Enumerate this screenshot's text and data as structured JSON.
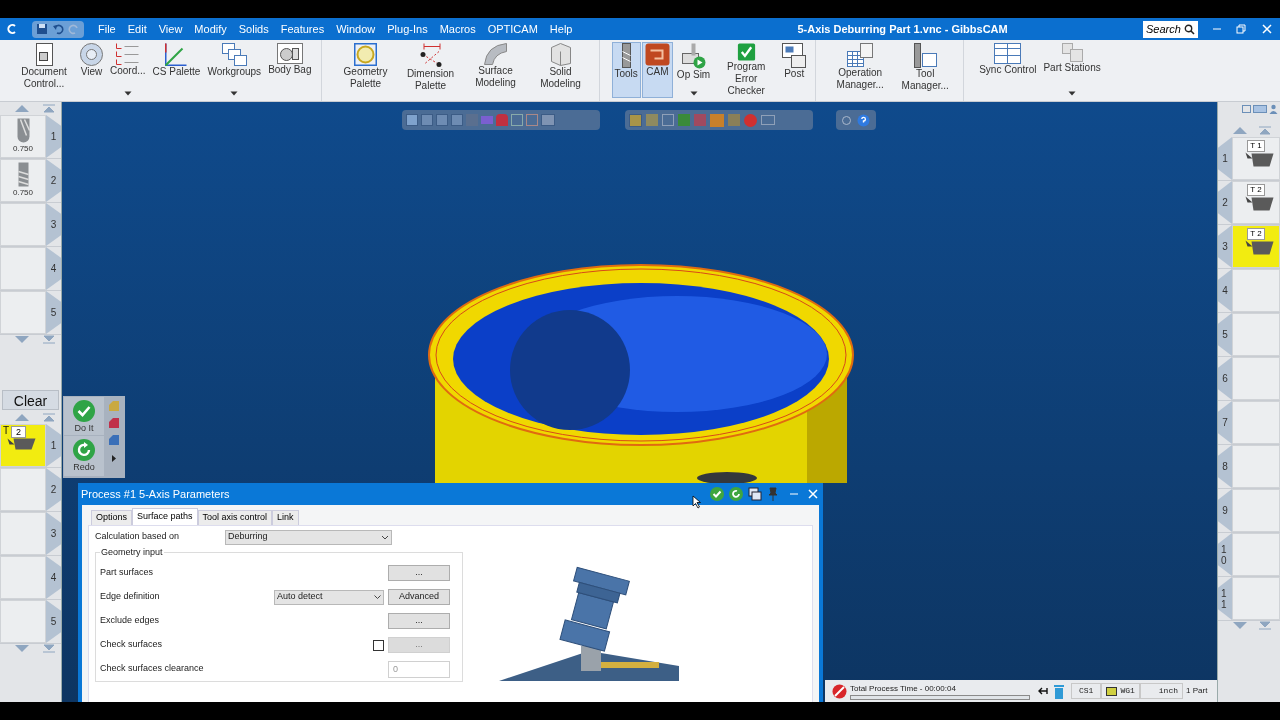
{
  "window": {
    "title": "5-Axis Deburring Part 1.vnc - GibbsCAM",
    "search_placeholder": "Search"
  },
  "menu": [
    "File",
    "Edit",
    "View",
    "Modify",
    "Solids",
    "Features",
    "Window",
    "Plug-Ins",
    "Macros",
    "OPTICAM",
    "Help"
  ],
  "ribbon_groups": [
    [
      {
        "label": "Document Control...",
        "selected": false,
        "dropdown": false
      },
      {
        "label": "View",
        "selected": false,
        "dropdown": false
      },
      {
        "label": "Coord...",
        "selected": false,
        "dropdown": true
      },
      {
        "label": "CS Palette",
        "selected": false,
        "dropdown": false
      },
      {
        "label": "Workgroups",
        "selected": false,
        "dropdown": true
      },
      {
        "label": "Body Bag",
        "selected": false,
        "dropdown": false
      }
    ],
    [
      {
        "label": "Geometry Palette",
        "selected": false,
        "dropdown": false
      },
      {
        "label": "Dimension Palette",
        "selected": false,
        "dropdown": false
      },
      {
        "label": "Surface Modeling",
        "selected": false,
        "dropdown": false
      },
      {
        "label": "Solid Modeling",
        "selected": false,
        "dropdown": false
      }
    ],
    [
      {
        "label": "Tools",
        "selected": true,
        "dropdown": false
      },
      {
        "label": "CAM",
        "selected": true,
        "dropdown": false
      },
      {
        "label": "Op Sim",
        "selected": false,
        "dropdown": true
      },
      {
        "label": "Program Error Checker",
        "selected": false,
        "dropdown": false
      },
      {
        "label": "Post",
        "selected": false,
        "dropdown": false
      }
    ],
    [
      {
        "label": "Operation Manager...",
        "selected": false,
        "dropdown": false
      },
      {
        "label": "Tool Manager...",
        "selected": false,
        "dropdown": false
      }
    ],
    [
      {
        "label": "Sync Control",
        "selected": false,
        "dropdown": false
      },
      {
        "label": "Part Stations",
        "selected": false,
        "dropdown": true
      }
    ]
  ],
  "tool_list": [
    {
      "number": "1",
      "kind": "ball",
      "size": "0.750"
    },
    {
      "number": "2",
      "kind": "flat",
      "size": "0.750"
    },
    {
      "number": "3",
      "kind": "empty"
    },
    {
      "number": "4",
      "kind": "empty"
    },
    {
      "number": "5",
      "kind": "empty"
    }
  ],
  "process_list": {
    "clear": "Clear",
    "do_it": "Do It",
    "redo": "Redo",
    "items": [
      {
        "number": "1",
        "tool_letter": "T",
        "tool": "2",
        "filled": true
      },
      {
        "number": "2",
        "filled": false
      },
      {
        "number": "3",
        "filled": false
      },
      {
        "number": "4",
        "filled": false
      },
      {
        "number": "5",
        "filled": false
      }
    ]
  },
  "operations": [
    {
      "number": "1",
      "tool": "T 1",
      "selected": false
    },
    {
      "number": "2",
      "tool": "T 2",
      "selected": false
    },
    {
      "number": "3",
      "tool": "T 2",
      "selected": true
    },
    {
      "number": "4"
    },
    {
      "number": "5"
    },
    {
      "number": "6"
    },
    {
      "number": "7"
    },
    {
      "number": "8"
    },
    {
      "number": "9"
    },
    {
      "number": "10"
    },
    {
      "number": "11"
    }
  ],
  "dialog": {
    "title": "Process #1 5-Axis Parameters",
    "tabs": [
      {
        "label": "Options",
        "selected": false
      },
      {
        "label": "Surface paths",
        "selected": true
      },
      {
        "label": "Tool axis control",
        "selected": false
      },
      {
        "label": "Link",
        "selected": false
      }
    ],
    "calculation": {
      "label": "Calculation based on",
      "value": "Deburring"
    },
    "group_title": "Geometry input",
    "rows": [
      {
        "kind": "button",
        "label": "Part surfaces",
        "button": "..."
      },
      {
        "kind": "dropdown",
        "label": "Edge definition",
        "value": "Auto detect",
        "button": "Advanced"
      },
      {
        "kind": "button",
        "label": "Exclude edges",
        "button": "..."
      },
      {
        "kind": "checkbox",
        "label": "Check surfaces",
        "checked": false,
        "button": "..."
      },
      {
        "kind": "input",
        "label": "Check surfaces clearance",
        "placeholder": "0"
      }
    ]
  },
  "status_bar": {
    "process_time": "Total Process Time - 00:00:04",
    "level": 0,
    "cs": "CS1",
    "wg": "WG1",
    "units": "inch",
    "parts": "1 Part"
  }
}
